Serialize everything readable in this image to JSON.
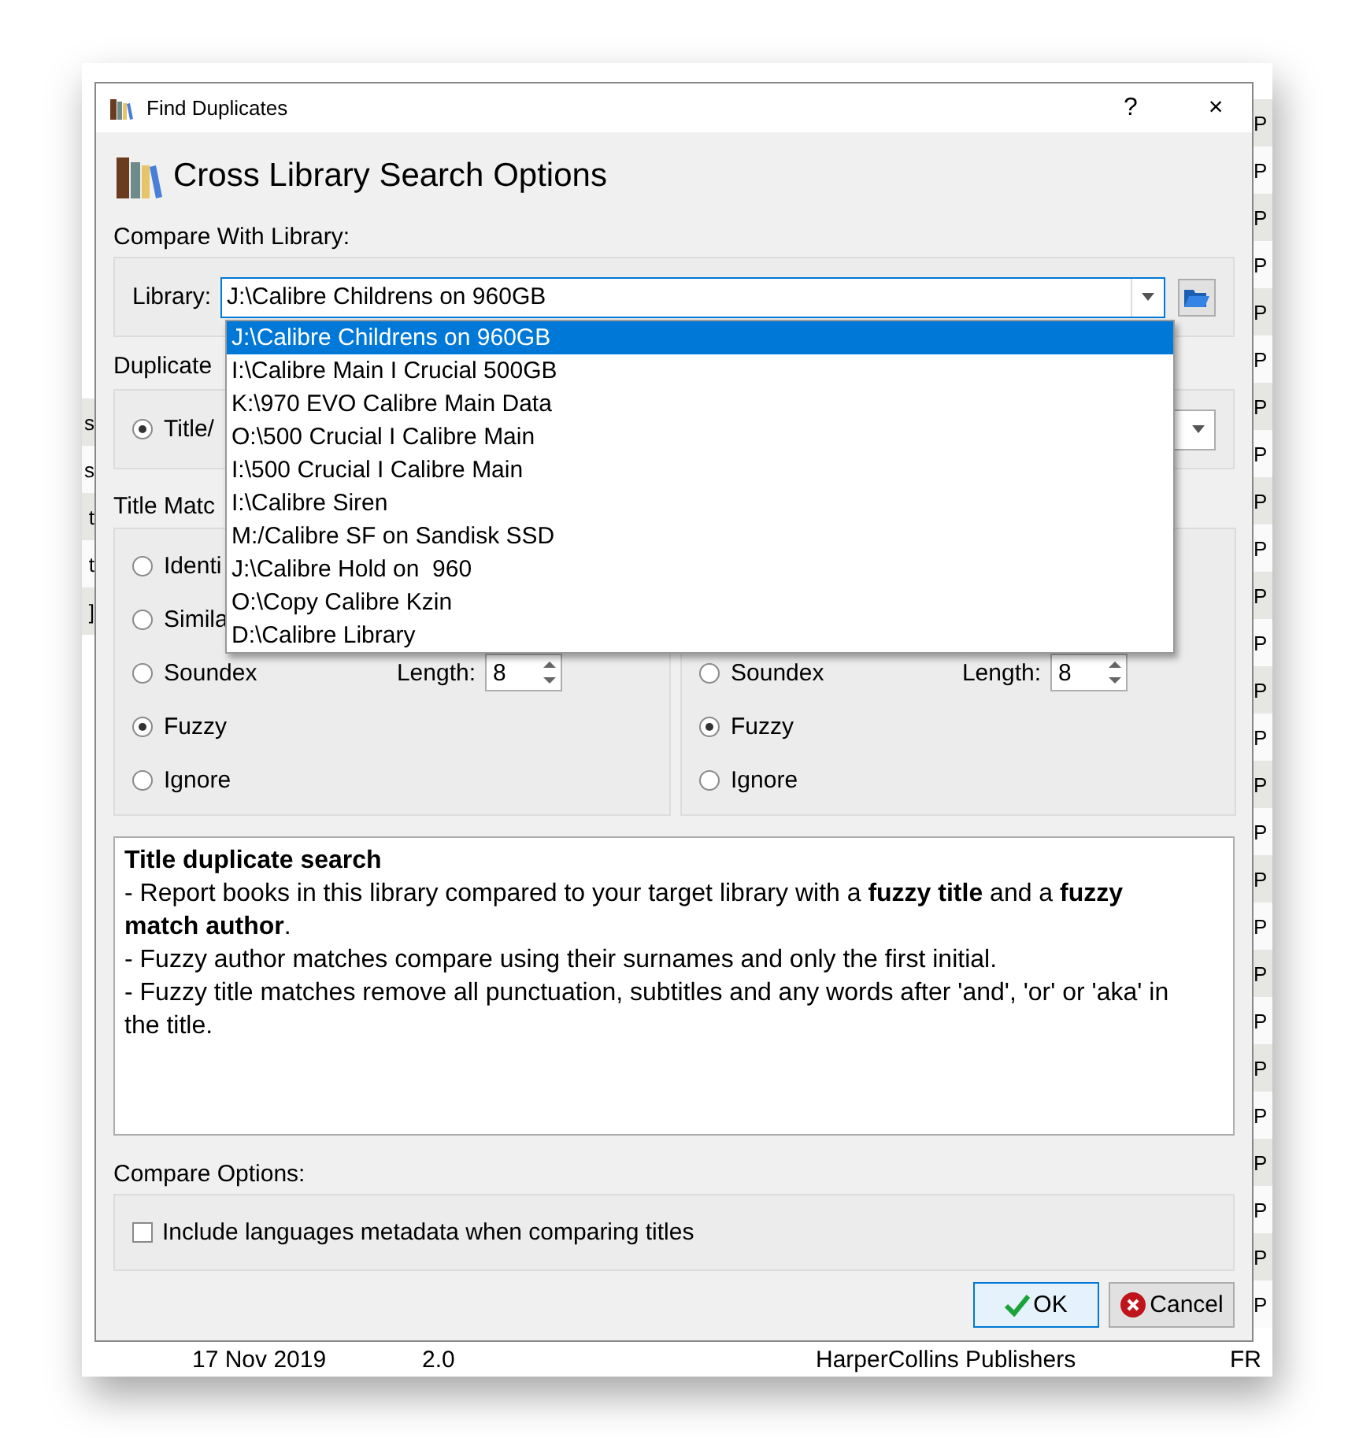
{
  "background": {
    "left_fragments": [
      "s",
      "s",
      "t",
      "t",
      "]"
    ],
    "right_column": [
      "P",
      "P",
      "P",
      "P",
      "P",
      "P",
      "P",
      "P",
      "P",
      "P",
      "P",
      "P",
      "P",
      "P",
      "P",
      "P",
      "P",
      "P",
      "P",
      "P",
      "P",
      "P",
      "P",
      "P",
      "P",
      "P"
    ],
    "bottom_row": [
      "17 Nov 2019",
      "2.0",
      "HarperCollins Publishers",
      "FR"
    ]
  },
  "window": {
    "title": "Find Duplicates",
    "help": "?",
    "close": "×"
  },
  "heading": "Cross Library Search Options",
  "library_section": {
    "label": "Compare With Library:",
    "field_label": "Library:",
    "value": "J:\\Calibre Childrens on 960GB",
    "expanded": true,
    "options": [
      {
        "label": "J:\\Calibre Childrens on 960GB",
        "selected": true
      },
      {
        "label": "I:\\Calibre Main I Crucial 500GB",
        "selected": false
      },
      {
        "label": "K:\\970 EVO Calibre Main Data",
        "selected": false
      },
      {
        "label": "O:\\500 Crucial I Calibre Main",
        "selected": false
      },
      {
        "label": "I:\\500 Crucial I Calibre Main",
        "selected": false
      },
      {
        "label": "I:\\Calibre Siren",
        "selected": false
      },
      {
        "label": "M:/Calibre SF on Sandisk SSD",
        "selected": false
      },
      {
        "label": "J:\\Calibre Hold on  960",
        "selected": false
      },
      {
        "label": "O:\\Copy Calibre Kzin",
        "selected": false
      },
      {
        "label": "D:\\Calibre Library",
        "selected": false
      }
    ]
  },
  "duplicate_section": {
    "label": "Duplicate",
    "options": [
      {
        "label": "Title/",
        "selected": true
      }
    ]
  },
  "title_match": {
    "label": "Title Matc",
    "options": [
      {
        "label": "Identi",
        "selected": false
      },
      {
        "label": "Simila",
        "selected": false
      },
      {
        "label": "Soundex",
        "selected": false,
        "length_label": "Length:",
        "length": "8"
      },
      {
        "label": "Fuzzy",
        "selected": true
      },
      {
        "label": "Ignore",
        "selected": false
      }
    ]
  },
  "author_match": {
    "options": [
      {
        "label": "Soundex",
        "selected": false,
        "length_label": "Length:",
        "length": "8"
      },
      {
        "label": "Fuzzy",
        "selected": true
      },
      {
        "label": "Ignore",
        "selected": false
      }
    ]
  },
  "description": {
    "title": "Title duplicate search",
    "lines": [
      "- Report books in this library compared to your target library with a **fuzzy title** and a **fuzzy match author**.",
      "- Fuzzy author matches compare using their surnames and only the first initial.",
      "- Fuzzy title matches remove all punctuation, subtitles and any words after 'and', 'or' or 'aka' in the title."
    ]
  },
  "compare_options": {
    "label": "Compare Options:",
    "checkbox": {
      "label": "Include languages metadata when comparing titles",
      "checked": false
    }
  },
  "buttons": [
    {
      "label": "OK",
      "kind": "ok"
    },
    {
      "label": "Cancel",
      "kind": "cancel"
    }
  ]
}
